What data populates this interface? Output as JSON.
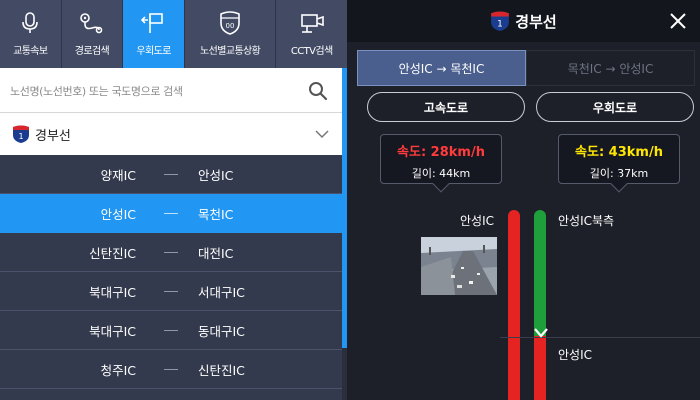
{
  "left_panel": {
    "tabs": [
      {
        "label": "교통속보",
        "icon": "microphone-icon"
      },
      {
        "label": "경로검색",
        "icon": "route-icon"
      },
      {
        "label": "우회도로",
        "icon": "detour-sign-icon"
      },
      {
        "label": "노선별교통상황",
        "icon": "highway-shield-icon"
      },
      {
        "label": "CCTV검색",
        "icon": "cctv-camera-icon"
      }
    ],
    "active_tab": 2,
    "search": {
      "placeholder": "노선명(노선번호) 또는 국도명으로 검색",
      "value": ""
    },
    "route_select": {
      "selected": "경부선",
      "shield_number": "1"
    },
    "sections": [
      {
        "from": "양재IC",
        "to": "안성IC"
      },
      {
        "from": "안성IC",
        "to": "목천IC"
      },
      {
        "from": "신탄진IC",
        "to": "대전IC"
      },
      {
        "from": "북대구IC",
        "to": "서대구IC"
      },
      {
        "from": "북대구IC",
        "to": "동대구IC"
      },
      {
        "from": "청주IC",
        "to": "신탄진IC"
      }
    ],
    "selected_section": 1
  },
  "right_panel": {
    "title": "경부선",
    "shield_number": "1",
    "directions": {
      "active": "안성IC → 목천IC",
      "inactive": "목천IC → 안성IC"
    },
    "road_types": {
      "highway": "고속도로",
      "detour": "우회도로"
    },
    "highway_info": {
      "speed": "속도: 28km/h",
      "length": "길이: 44km",
      "speed_color": "#ff3b3b"
    },
    "detour_info": {
      "speed": "속도: 43km/h",
      "length": "길이: 37km",
      "speed_color": "#ffe600"
    },
    "nodes": {
      "highway_start": "안성IC",
      "detour_start": "안성IC북측",
      "detour_mid": "안성IC"
    },
    "bar_colors": {
      "highway": "#e52421",
      "detour_congested": "#e52421",
      "detour_free": "#1f9e3c"
    }
  },
  "colors": {
    "accent": "#2196f3",
    "panel_dark": "#343a4e",
    "tab_bg": "#434b64"
  }
}
